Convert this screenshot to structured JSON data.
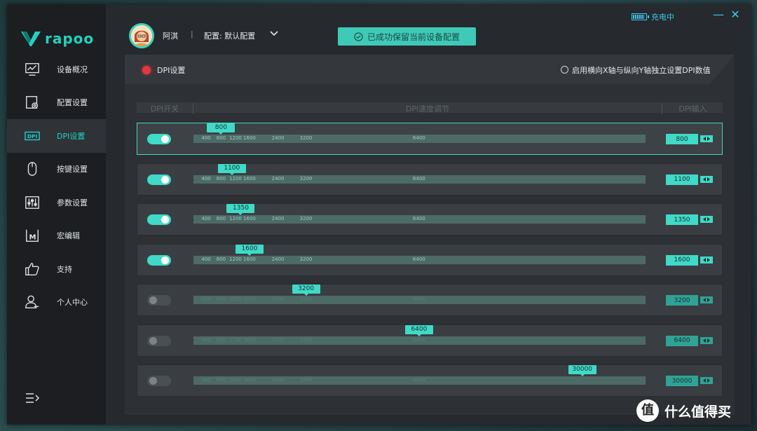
{
  "app": {
    "brand": "rapoo",
    "battery_status": "充电中",
    "minimize_glyph": "—",
    "close_glyph": "✕"
  },
  "sidebar": {
    "items": [
      {
        "label": "设备概况",
        "icon": "monitor-chart-icon",
        "active": false
      },
      {
        "label": "配置设置",
        "icon": "config-gear-icon",
        "active": false
      },
      {
        "label": "DPI设置",
        "icon": "dpi-icon",
        "active": true
      },
      {
        "label": "按键设置",
        "icon": "mouse-icon",
        "active": false
      },
      {
        "label": "参数设置",
        "icon": "sliders-icon",
        "active": false
      },
      {
        "label": "宏编辑",
        "icon": "macro-icon",
        "active": false
      },
      {
        "label": "支持",
        "icon": "thumbs-up-icon",
        "active": false
      },
      {
        "label": "个人中心",
        "icon": "user-icon",
        "active": false
      }
    ],
    "collapse_icon": "collapse-menu-icon"
  },
  "header": {
    "user_name": "阿淇",
    "separator": "|",
    "profile_label": "配置: 默认配置",
    "toast": "已成功保留当前设备配置"
  },
  "panel": {
    "title": "DPI设置",
    "xy_option_label": "启用横向X轴与纵向Y轴独立设置DPI数值",
    "xy_option_checked": false,
    "columns": {
      "toggle": "DPI开关",
      "slider": "DPI速度调节",
      "input": "DPI输入"
    }
  },
  "slider_ticks": [
    "400",
    "800",
    "1200",
    "1600",
    "2400",
    "3200",
    "6400"
  ],
  "dpi_rows": [
    {
      "enabled": true,
      "value": "800",
      "selected": true
    },
    {
      "enabled": true,
      "value": "1100",
      "selected": false
    },
    {
      "enabled": true,
      "value": "1350",
      "selected": false
    },
    {
      "enabled": true,
      "value": "1600",
      "selected": false
    },
    {
      "enabled": false,
      "value": "3200",
      "selected": false
    },
    {
      "enabled": false,
      "value": "6400",
      "selected": false
    },
    {
      "enabled": false,
      "value": "30000",
      "selected": false
    }
  ],
  "colors": {
    "accent": "#3fdac8",
    "brand": "#1fd3c0",
    "indicator_red": "#e8363c",
    "battery": "#3ec8f0"
  },
  "watermark": {
    "text": "什么值得买",
    "glyph": "值"
  }
}
